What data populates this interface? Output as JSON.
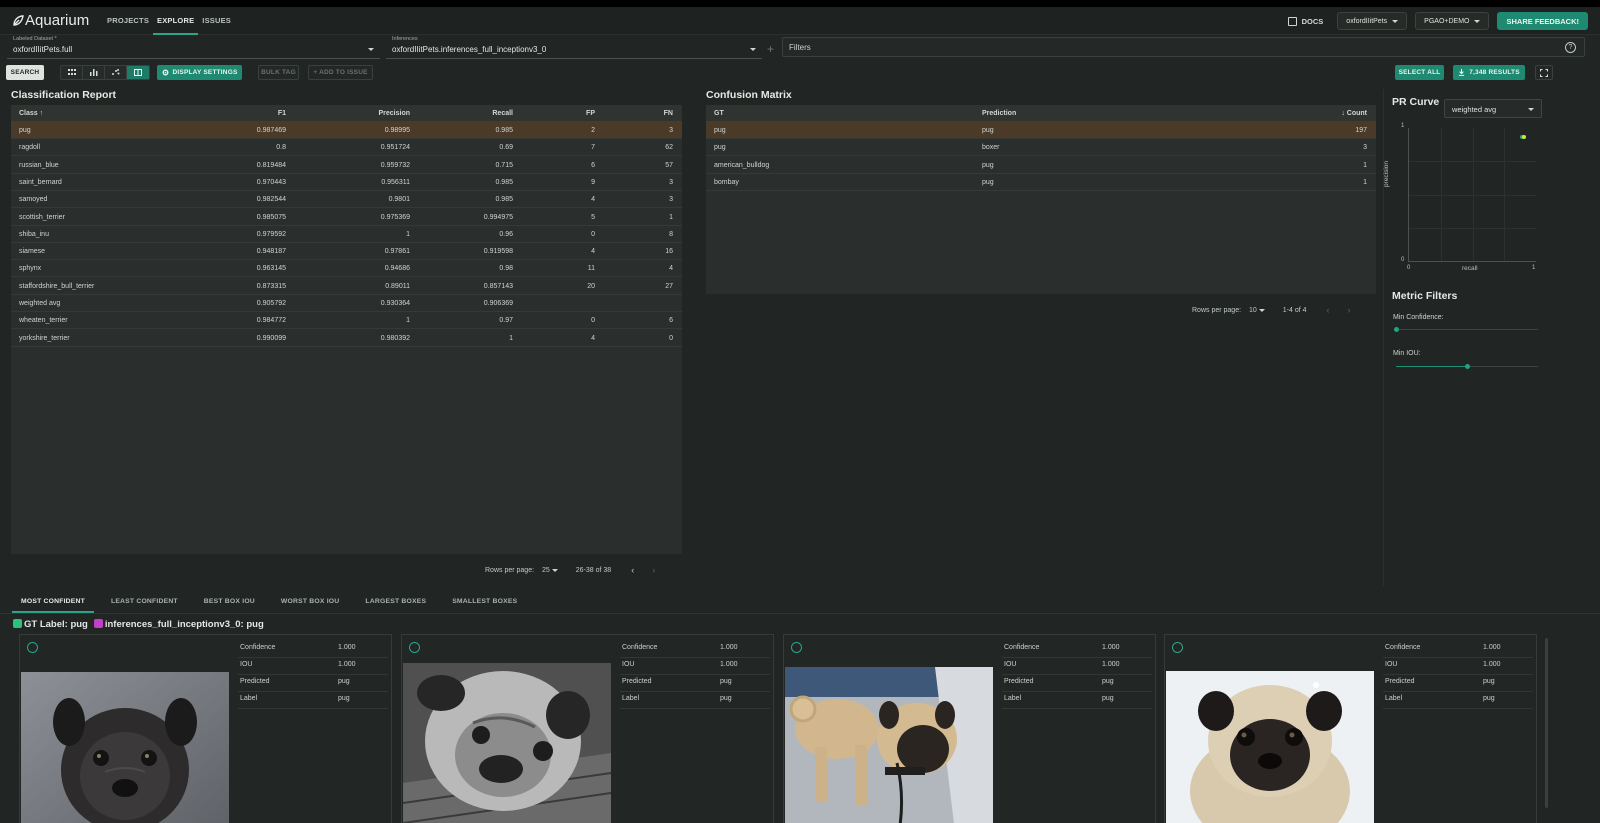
{
  "nav": {
    "logo": "Aquarium",
    "links": [
      "PROJECTS",
      "EXPLORE",
      "ISSUES"
    ],
    "docs": "DOCS",
    "project_select": "oxfordIIitPets",
    "user_select": "PGAO+DEMO",
    "share": "SHARE FEEDBACK!"
  },
  "datasets": {
    "labeled_label": "Labeled Dataset *",
    "labeled_value": "oxfordIIitPets.full",
    "inferences_label": "Inferences",
    "inferences_value": "oxfordIIitPets.inferences_full_inceptionv3_0",
    "plus": "+",
    "filters": "Filters",
    "help": "?"
  },
  "toolbar": {
    "search": "SEARCH",
    "display_settings": "DISPLAY SETTINGS",
    "bulk_tag": "BULK TAG",
    "add_to_issue": "+ ADD TO ISSUE",
    "select_all": "SELECT ALL",
    "results": "7,348 RESULTS"
  },
  "classification": {
    "title": "Classification Report",
    "headers": [
      "Class ↑",
      "F1",
      "Precision",
      "Recall",
      "FP",
      "FN"
    ],
    "rows": [
      [
        "pug",
        "0.987469",
        "0.98995",
        "0.985",
        "2",
        "3"
      ],
      [
        "ragdoll",
        "0.8",
        "0.951724",
        "0.69",
        "7",
        "62"
      ],
      [
        "russian_blue",
        "0.819484",
        "0.959732",
        "0.715",
        "6",
        "57"
      ],
      [
        "saint_bernard",
        "0.970443",
        "0.956311",
        "0.985",
        "9",
        "3"
      ],
      [
        "samoyed",
        "0.982544",
        "0.9801",
        "0.985",
        "4",
        "3"
      ],
      [
        "scottish_terrier",
        "0.985075",
        "0.975369",
        "0.994975",
        "5",
        "1"
      ],
      [
        "shiba_inu",
        "0.979592",
        "1",
        "0.96",
        "0",
        "8"
      ],
      [
        "siamese",
        "0.948187",
        "0.97861",
        "0.919598",
        "4",
        "16"
      ],
      [
        "sphynx",
        "0.963145",
        "0.94686",
        "0.98",
        "11",
        "4"
      ],
      [
        "staffordshire_bull_terrier",
        "0.873315",
        "0.89011",
        "0.857143",
        "20",
        "27"
      ],
      [
        "weighted avg",
        "0.905792",
        "0.930364",
        "0.906369",
        "",
        ""
      ],
      [
        "wheaten_terrier",
        "0.984772",
        "1",
        "0.97",
        "0",
        "6"
      ],
      [
        "yorkshire_terrier",
        "0.990099",
        "0.980392",
        "1",
        "4",
        "0"
      ]
    ],
    "rows_per_page_label": "Rows per page:",
    "rows_per_page": "25",
    "range": "26-38 of 38"
  },
  "confusion": {
    "title": "Confusion Matrix",
    "headers": [
      "GT",
      "Prediction",
      "↓ Count"
    ],
    "rows": [
      [
        "pug",
        "pug",
        "197"
      ],
      [
        "pug",
        "boxer",
        "3"
      ],
      [
        "american_bulldog",
        "pug",
        "1"
      ],
      [
        "bombay",
        "pug",
        "1"
      ]
    ],
    "rows_per_page_label": "Rows per page:",
    "rows_per_page": "10",
    "range": "1-4 of 4"
  },
  "pr_curve": {
    "title": "PR Curve",
    "select": "weighted avg",
    "ylabel": "precision",
    "xlabel": "recall",
    "x_ticks": [
      "0",
      "1"
    ],
    "y_ticks": [
      "1",
      "0"
    ],
    "point": {
      "recall": 0.906369,
      "precision": 0.930364
    },
    "point_color": "#d7e23a",
    "point_color_alt": "#2aa58a"
  },
  "metric_filters": {
    "title": "Metric Filters",
    "min_confidence_label": "Min Confidence:",
    "min_confidence": 0.0,
    "min_iou_label": "Min IOU:",
    "min_iou": 0.5
  },
  "bottom_tabs": [
    "MOST CONFIDENT",
    "LEAST CONFIDENT",
    "BEST BOX IOU",
    "WORST BOX IOU",
    "LARGEST BOXES",
    "SMALLEST BOXES"
  ],
  "legend": {
    "gt": "GT Label: pug",
    "gt_color": "#2bc27a",
    "inf": "inferences_full_inceptionv3_0: pug",
    "inf_color": "#c23fc9"
  },
  "cards": [
    {
      "meta": [
        [
          "Confidence",
          "1.000"
        ],
        [
          "IOU",
          "1.000"
        ],
        [
          "Predicted",
          "pug"
        ],
        [
          "Label",
          "pug"
        ]
      ]
    },
    {
      "meta": [
        [
          "Confidence",
          "1.000"
        ],
        [
          "IOU",
          "1.000"
        ],
        [
          "Predicted",
          "pug"
        ],
        [
          "Label",
          "pug"
        ]
      ]
    },
    {
      "meta": [
        [
          "Confidence",
          "1.000"
        ],
        [
          "IOU",
          "1.000"
        ],
        [
          "Predicted",
          "pug"
        ],
        [
          "Label",
          "pug"
        ]
      ]
    },
    {
      "meta": [
        [
          "Confidence",
          "1.000"
        ],
        [
          "IOU",
          "1.000"
        ],
        [
          "Predicted",
          "pug"
        ],
        [
          "Label",
          "pug"
        ]
      ]
    }
  ],
  "colors": {
    "accent": "#1e8a72",
    "highlight_row": "#4b3a28",
    "background": "#212523"
  }
}
